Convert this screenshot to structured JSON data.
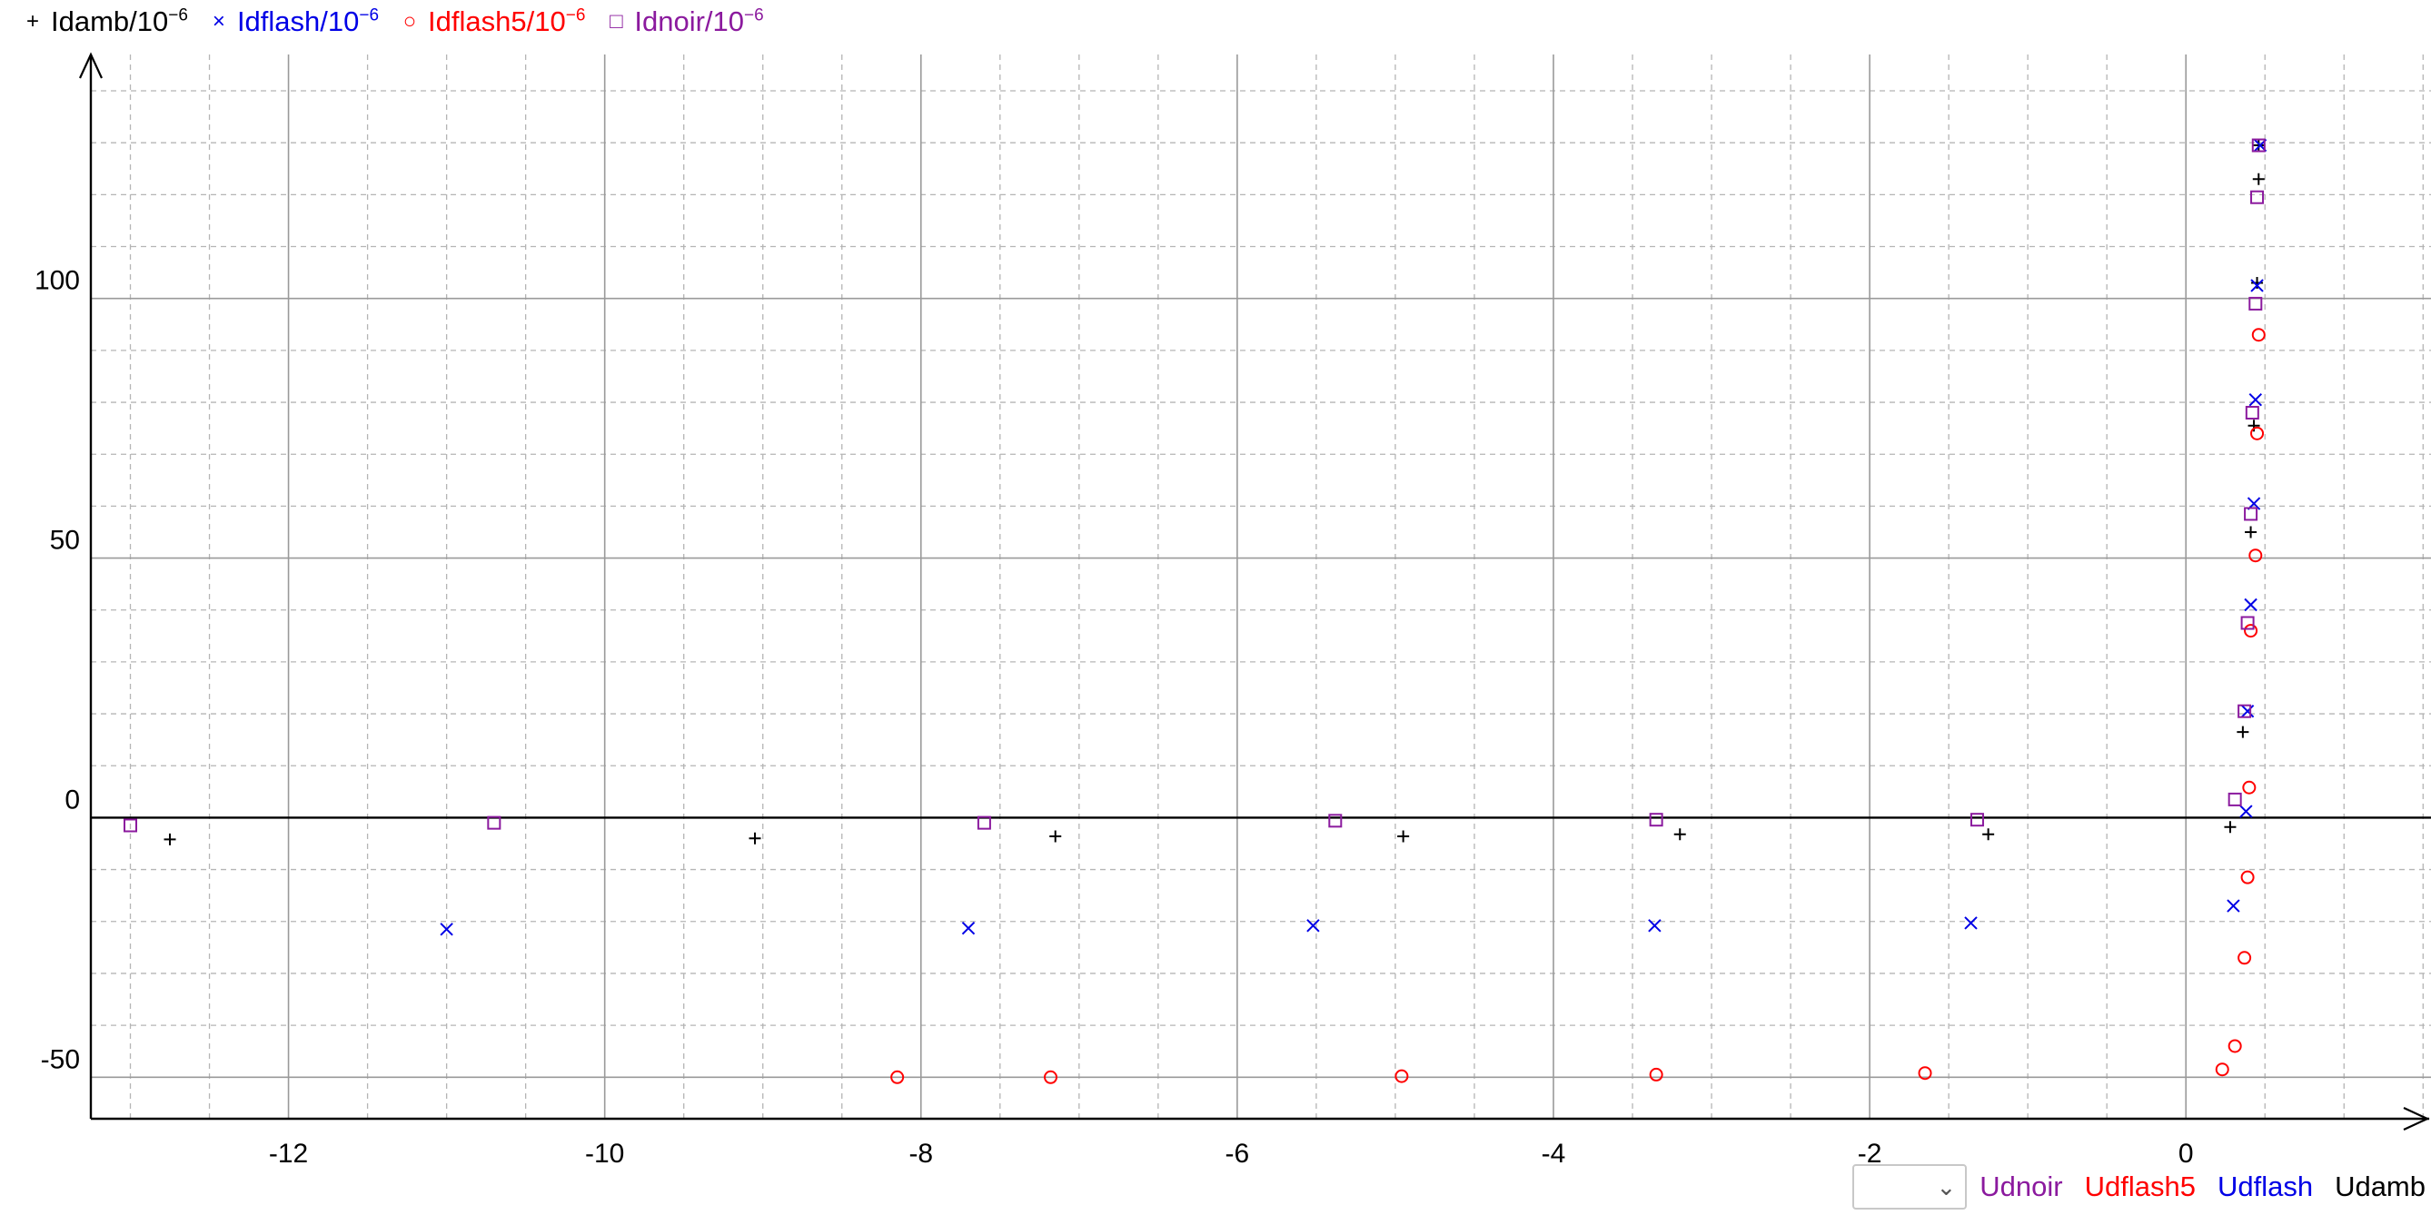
{
  "legend": [
    {
      "name": "Idamb/10",
      "sup": "−6",
      "color": "#000000",
      "marker": "+",
      "icon": "plus-marker-icon"
    },
    {
      "name": "Idflash/10",
      "sup": "−6",
      "color": "#0000e6",
      "marker": "×",
      "icon": "cross-marker-icon"
    },
    {
      "name": "Idflash5/10",
      "sup": "−6",
      "color": "#ff0000",
      "marker": "○",
      "icon": "circle-marker-icon"
    },
    {
      "name": "Idnoir/10",
      "sup": "−6",
      "color": "#8b1a9e",
      "marker": "□",
      "icon": "square-marker-icon"
    }
  ],
  "bottom_controls": {
    "select_value": "",
    "labels": [
      {
        "text": "Udnoir",
        "color": "#8b1a9e"
      },
      {
        "text": "Udflash5",
        "color": "#ff0000"
      },
      {
        "text": "Udflash",
        "color": "#0000e6"
      },
      {
        "text": "Udamb",
        "color": "#000000"
      }
    ]
  },
  "chart_data": {
    "type": "scatter",
    "xlim": [
      -13.25,
      1.55
    ],
    "ylim": [
      -58,
      147
    ],
    "x_ticks": [
      -12,
      -10,
      -8,
      -6,
      -4,
      -2,
      0
    ],
    "y_ticks": [
      -50,
      0,
      50,
      100
    ],
    "x_tick_labels": [
      "-12",
      "-10",
      "-8",
      "-6",
      "-4",
      "-2",
      "0"
    ],
    "y_tick_labels": [
      "-50",
      "0",
      "50",
      "100"
    ],
    "grid": true,
    "series": [
      {
        "name": "Idamb",
        "marker": "plus",
        "color": "#000000",
        "points": [
          [
            -12.75,
            -4.2
          ],
          [
            -9.05,
            -4
          ],
          [
            -7.15,
            -3.6
          ],
          [
            -4.95,
            -3.6
          ],
          [
            -3.2,
            -3.2
          ],
          [
            -1.25,
            -3.2
          ],
          [
            0.28,
            -1.8
          ],
          [
            0.36,
            16.5
          ],
          [
            0.41,
            55
          ],
          [
            0.43,
            75.5
          ],
          [
            0.45,
            103
          ],
          [
            0.46,
            123
          ],
          [
            0.46,
            129.5
          ]
        ]
      },
      {
        "name": "Idflash",
        "marker": "x",
        "color": "#0000e6",
        "points": [
          [
            -11.0,
            -21.5
          ],
          [
            -7.7,
            -21.3
          ],
          [
            -5.52,
            -20.8
          ],
          [
            -3.36,
            -20.8
          ],
          [
            -1.36,
            -20.3
          ],
          [
            0.3,
            -17
          ],
          [
            0.38,
            1.2
          ],
          [
            0.39,
            20.5
          ],
          [
            0.41,
            41
          ],
          [
            0.43,
            60.5
          ],
          [
            0.44,
            80.5
          ],
          [
            0.45,
            102.5
          ],
          [
            0.47,
            129.5
          ]
        ]
      },
      {
        "name": "Idflash5",
        "marker": "circle",
        "color": "#ff0000",
        "points": [
          [
            -8.15,
            -50
          ],
          [
            -7.18,
            -50
          ],
          [
            -4.96,
            -49.8
          ],
          [
            -3.35,
            -49.5
          ],
          [
            -1.65,
            -49.2
          ],
          [
            0.23,
            -48.5
          ],
          [
            0.31,
            -44
          ],
          [
            0.37,
            -27
          ],
          [
            0.39,
            -11.5
          ],
          [
            0.4,
            5.8
          ],
          [
            0.41,
            36
          ],
          [
            0.44,
            50.5
          ],
          [
            0.45,
            74
          ],
          [
            0.46,
            93
          ]
        ]
      },
      {
        "name": "Idnoir",
        "marker": "square",
        "color": "#8b1a9e",
        "points": [
          [
            -13.0,
            -1.5
          ],
          [
            -10.7,
            -1
          ],
          [
            -7.6,
            -1
          ],
          [
            -5.38,
            -0.6
          ],
          [
            -3.35,
            -0.4
          ],
          [
            -1.32,
            -0.4
          ],
          [
            0.31,
            3.5
          ],
          [
            0.37,
            20.5
          ],
          [
            0.39,
            37.5
          ],
          [
            0.41,
            58.5
          ],
          [
            0.42,
            78
          ],
          [
            0.44,
            99
          ],
          [
            0.45,
            119.5
          ],
          [
            0.46,
            129.5
          ]
        ]
      }
    ]
  }
}
